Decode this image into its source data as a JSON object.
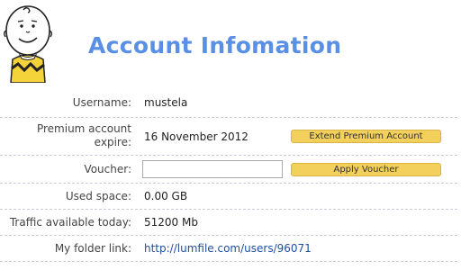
{
  "page": {
    "title": "Account Infomation"
  },
  "account": {
    "username_label": "Username:",
    "username_value": "mustela",
    "premium_label_line1": "Premium account",
    "premium_label_line2": "expire:",
    "premium_value": "16 November 2012",
    "extend_button": "Extend Premium Account",
    "voucher_label": "Voucher:",
    "voucher_value": "",
    "voucher_placeholder": "",
    "apply_button": "Apply Voucher",
    "used_label": "Used space:",
    "used_value": "0.00 GB",
    "traffic_label": "Traffic available today:",
    "traffic_value": "51200 Mb",
    "folder_label": "My folder link:",
    "folder_value": "http://lumfile.com/users/96071"
  },
  "colors": {
    "title": "#5a8fe6",
    "button": "#f3cf5c",
    "link": "#1f4fa3",
    "divider": "#c9cdd8"
  },
  "icons": {
    "mascot": "charlie-brown-mascot"
  }
}
